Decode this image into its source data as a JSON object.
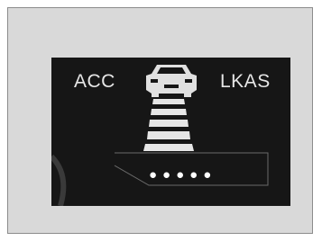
{
  "screen": {
    "acc_label": "ACC",
    "lkas_label": "LKAS",
    "distance_dots": "●●●●●",
    "icons": {
      "vehicle": "vehicle-ahead-icon",
      "lane": "lane-bars-icon"
    },
    "colors": {
      "display_bg": "#161616",
      "text": "#e6e6e6",
      "frame_bg": "#d9d9d9"
    }
  }
}
